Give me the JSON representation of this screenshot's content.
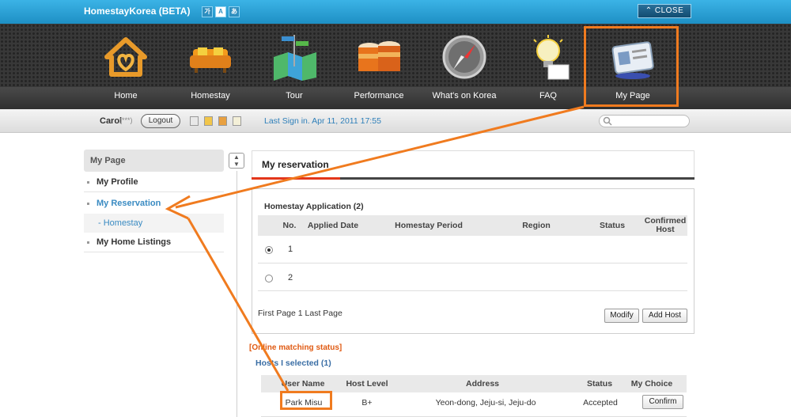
{
  "window": {
    "title": "HomestayKorea (BETA)",
    "font_size_buttons": [
      "가",
      "A",
      "あ"
    ],
    "close_label": "CLOSE"
  },
  "nav": {
    "items": [
      {
        "label": "Home",
        "icon": "home-icon"
      },
      {
        "label": "Homestay",
        "icon": "sofa-icon"
      },
      {
        "label": "Tour",
        "icon": "map-icon"
      },
      {
        "label": "Performance",
        "icon": "drum-icon"
      },
      {
        "label": "What's on Korea",
        "icon": "compass-icon"
      },
      {
        "label": "FAQ",
        "icon": "lightbulb-icon"
      },
      {
        "label": "My Page",
        "icon": "id-badge-icon"
      }
    ],
    "active": "My Page"
  },
  "user_bar": {
    "user_name": "Carol",
    "user_masked": "(***)",
    "logout_label": "Logout",
    "last_signin_label": "Last Sign in.",
    "last_signin_value": "Apr 11, 2011 17:55",
    "search_placeholder": ""
  },
  "sidebar": {
    "header": "My Page",
    "items": [
      {
        "label": "My Profile"
      },
      {
        "label": "My Reservation"
      },
      {
        "label": "My Home Listings"
      }
    ],
    "sub_item": "- Homestay"
  },
  "main": {
    "tab_title": "My reservation",
    "application": {
      "title": "Homestay Application (2)",
      "columns": [
        "No.",
        "Applied Date",
        "Homestay Period",
        "Region",
        "Status",
        "Confirmed Host"
      ],
      "rows": [
        {
          "no": "1",
          "selected": true
        },
        {
          "no": "2",
          "selected": false
        }
      ],
      "paging": "First Page 1 Last Page",
      "modify_label": "Modify",
      "add_host_label": "Add Host"
    },
    "online_matching": {
      "status_label": "[Online matching status]",
      "hosts_selected": "Hosts I selected (1)",
      "columns": [
        "User Name",
        "Host Level",
        "Address",
        "Status",
        "My Choice"
      ],
      "rows": [
        {
          "user_name": "Park Misu",
          "host_level": "B+",
          "address": "Yeon-dong, Jeju-si, Jeju-do",
          "status": "Accepted",
          "choice_label": "Confirm"
        }
      ]
    }
  },
  "colors": {
    "topbar": "#2aa1d8",
    "highlight": "#f07b1f",
    "link_blue": "#3a8bc2",
    "tab_red": "#e3361a"
  }
}
